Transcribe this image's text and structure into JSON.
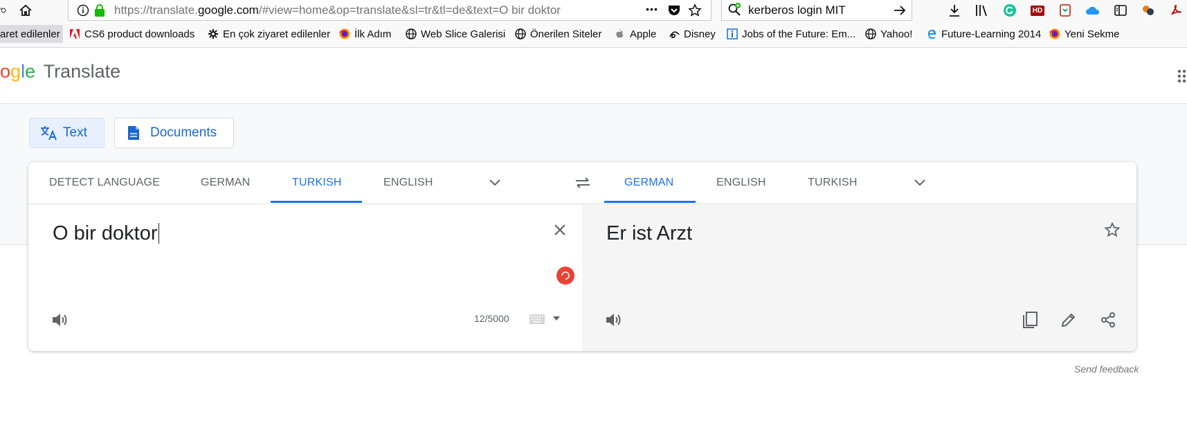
{
  "browser": {
    "url_prefix": "https://translate.",
    "url_domain": "google.com",
    "url_rest": "/#view=home&op=translate&sl=tr&tl=de&text=O bir doktor",
    "page_actions_label": "•••",
    "search_text": "kerberos login MIT",
    "addon_hd": "HD"
  },
  "bookmarks": [
    {
      "label": "aret edilenler",
      "icon": "folder"
    },
    {
      "label": "CS6 product downloads",
      "icon": "adobe-icon"
    },
    {
      "label": "En çok ziyaret edilenler",
      "icon": "gear-icon"
    },
    {
      "label": "İlk Adım",
      "icon": "firefox-icon"
    },
    {
      "label": "Web Slice Galerisi",
      "icon": "globe-icon"
    },
    {
      "label": "Önerilen Siteler",
      "icon": "globe-icon"
    },
    {
      "label": "Apple",
      "icon": "apple-icon"
    },
    {
      "label": "Disney",
      "icon": "disney-icon"
    },
    {
      "label": "Jobs of the Future: Em...",
      "icon": "info-icon"
    },
    {
      "label": "Yahoo!",
      "icon": "globe-icon"
    },
    {
      "label": "Future-Learning 2014",
      "icon": "edge-icon"
    },
    {
      "label": "Yeni Sekme",
      "icon": "firefox-icon"
    }
  ],
  "app": {
    "logo_partial": "ogle",
    "product": "Translate",
    "modes": {
      "text": "Text",
      "documents": "Documents"
    }
  },
  "source_langs": [
    "DETECT LANGUAGE",
    "GERMAN",
    "TURKISH",
    "ENGLISH"
  ],
  "target_langs": [
    "GERMAN",
    "ENGLISH",
    "TURKISH"
  ],
  "active": {
    "source": "TURKISH",
    "target": "GERMAN"
  },
  "source": {
    "text": "O bir doktor",
    "char_count": "12/5000"
  },
  "target": {
    "text": "Er ist Arzt"
  },
  "footer": {
    "feedback": "Send feedback"
  },
  "colors": {
    "accent": "#1a73e8",
    "spinner": "#ea4335",
    "grey_band": "#f8f9fa"
  }
}
